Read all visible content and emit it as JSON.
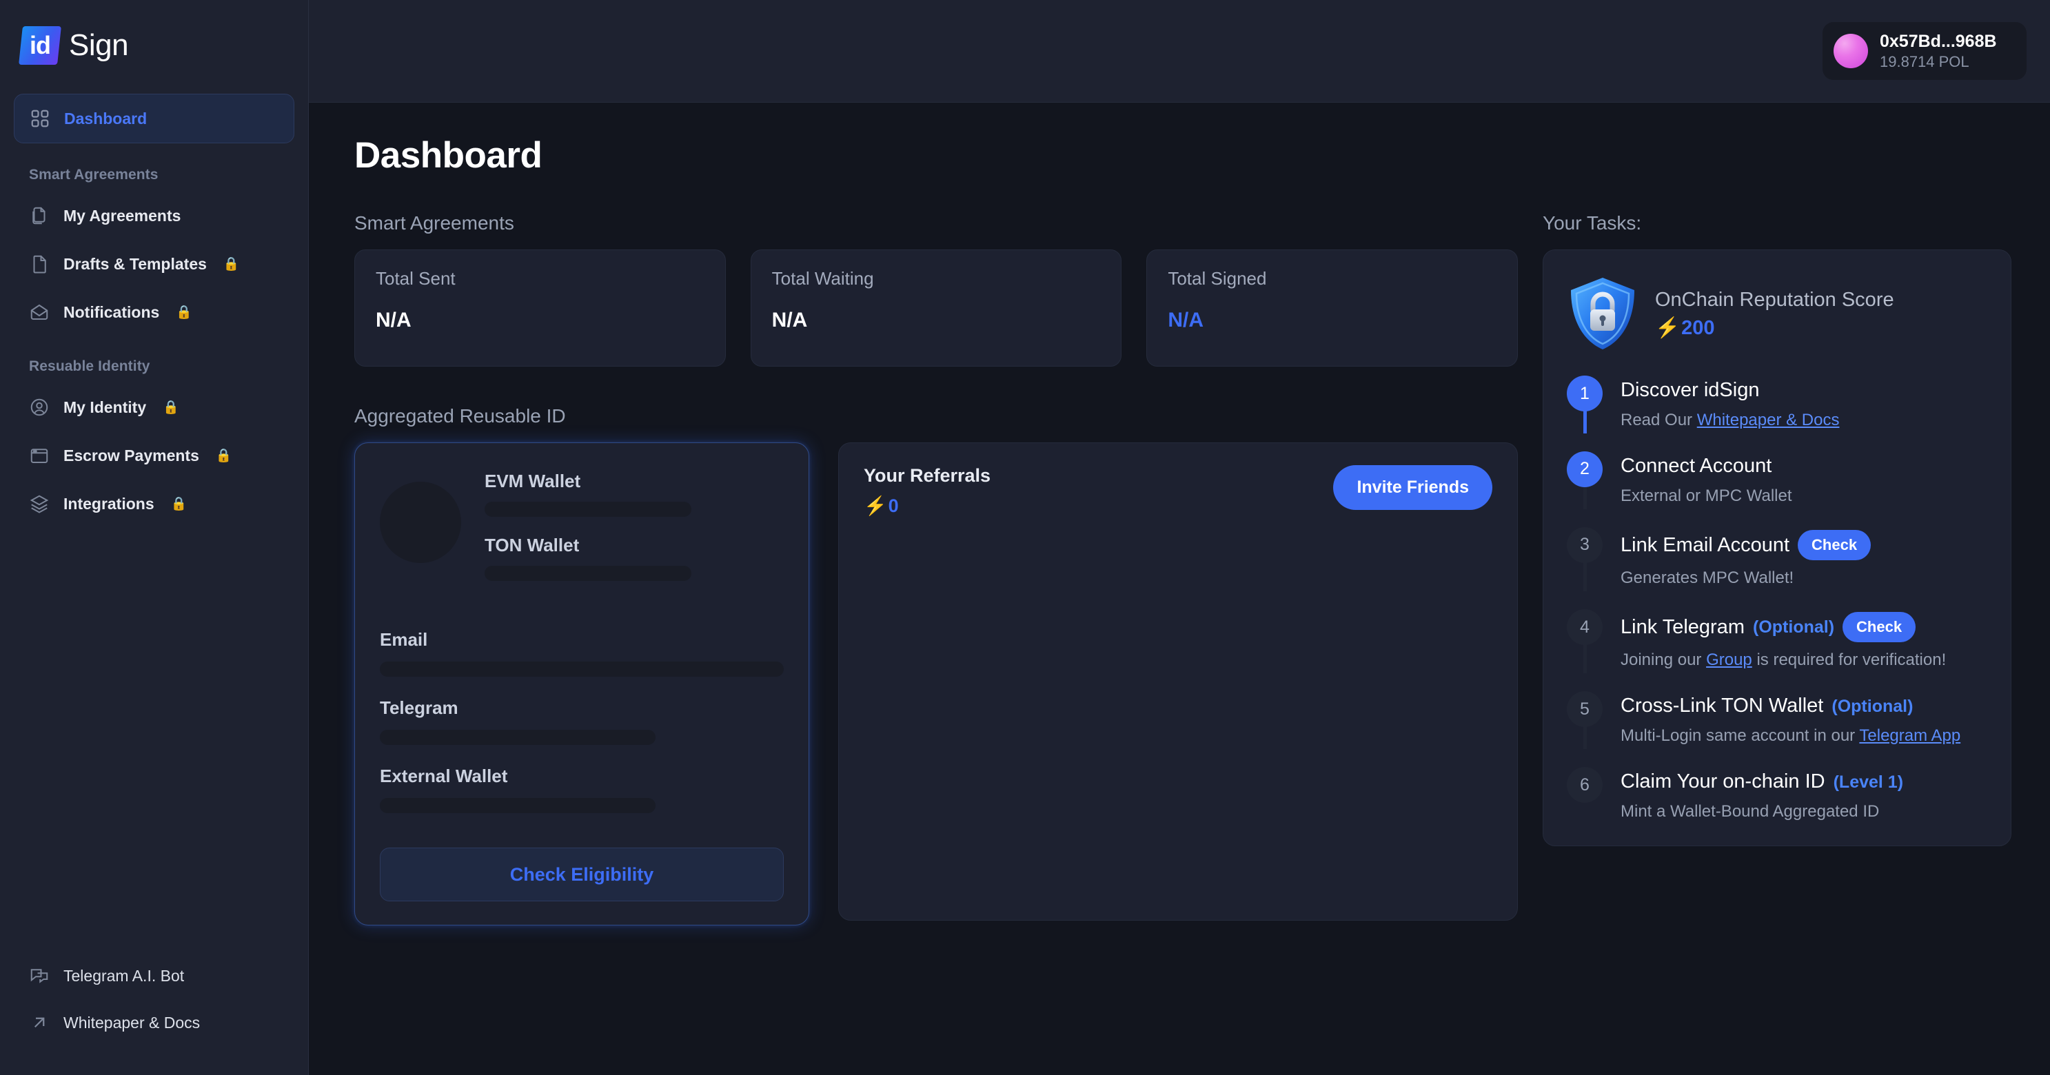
{
  "brand": {
    "mark": "id",
    "name": "Sign"
  },
  "sidebar": {
    "primary": [
      {
        "label": "Dashboard",
        "icon": "grid-icon",
        "locked": false,
        "active": true
      }
    ],
    "sections": [
      {
        "title": "Smart Agreements",
        "items": [
          {
            "label": "My Agreements",
            "icon": "documents-icon",
            "lock": ""
          },
          {
            "label": "Drafts & Templates",
            "icon": "document-icon",
            "lock": "🔒"
          },
          {
            "label": "Notifications",
            "icon": "envelope-open-icon",
            "lock": "🔒"
          }
        ]
      },
      {
        "title": "Resuable Identity",
        "items": [
          {
            "label": "My Identity",
            "icon": "user-circle-icon",
            "lock": "🔒"
          },
          {
            "label": "Escrow Payments",
            "icon": "browser-window-icon",
            "lock": "🔒"
          },
          {
            "label": "Integrations",
            "icon": "layers-icon",
            "lock": "🔒"
          }
        ]
      }
    ],
    "footer": [
      {
        "label": "Telegram A.I. Bot",
        "icon": "chat-bubbles-icon"
      },
      {
        "label": "Whitepaper & Docs",
        "icon": "arrow-up-right-icon"
      }
    ]
  },
  "topbar": {
    "wallet": {
      "address": "0x57Bd...968B",
      "balance": "19.8714 POL"
    }
  },
  "page": {
    "title": "Dashboard"
  },
  "smart_agreements": {
    "section_label": "Smart Agreements",
    "stats": [
      {
        "label": "Total Sent",
        "value": "N/A",
        "accent": false
      },
      {
        "label": "Total Waiting",
        "value": "N/A",
        "accent": false
      },
      {
        "label": "Total Signed",
        "value": "N/A",
        "accent": true
      }
    ]
  },
  "aggregated_id": {
    "section_label": "Aggregated Reusable ID",
    "evm_label": "EVM Wallet",
    "ton_label": "TON Wallet",
    "email_label": "Email",
    "telegram_label": "Telegram",
    "external_label": "External Wallet",
    "check_button": "Check Eligibility"
  },
  "referrals": {
    "title": "Your Referrals",
    "bolt": "⚡",
    "count": "0",
    "invite_button": "Invite Friends"
  },
  "tasks": {
    "heading": "Your Tasks:",
    "score": {
      "label": "OnChain Reputation Score",
      "bolt": "⚡",
      "value": "200"
    },
    "items": [
      {
        "number": "1",
        "state": "done",
        "title": "Discover idSign",
        "tag": "",
        "button": "",
        "desc_prefix": "Read Our ",
        "desc_link": "Whitepaper & Docs",
        "desc_suffix": ""
      },
      {
        "number": "2",
        "state": "done",
        "title": "Connect Account",
        "tag": "",
        "button": "",
        "desc_prefix": "External or MPC Wallet",
        "desc_link": "",
        "desc_suffix": ""
      },
      {
        "number": "3",
        "state": "todo",
        "title": "Link Email Account",
        "tag": "",
        "button": "Check",
        "desc_prefix": "Generates MPC Wallet!",
        "desc_link": "",
        "desc_suffix": ""
      },
      {
        "number": "4",
        "state": "todo",
        "title": "Link Telegram",
        "tag": "(Optional)",
        "button": "Check",
        "desc_prefix": "Joining our ",
        "desc_link": "Group",
        "desc_suffix": " is required for verification!"
      },
      {
        "number": "5",
        "state": "todo",
        "title": "Cross-Link TON Wallet",
        "tag": "(Optional)",
        "button": "",
        "desc_prefix": "Multi-Login same account in our ",
        "desc_link": "Telegram App",
        "desc_suffix": ""
      },
      {
        "number": "6",
        "state": "todo",
        "title": "Claim Your on-chain ID",
        "tag": "(Level 1)",
        "button": "",
        "desc_prefix": "Mint a Wallet-Bound Aggregated ID",
        "desc_link": "",
        "desc_suffix": ""
      }
    ]
  },
  "colors": {
    "accent": "#3d6df5",
    "link": "#5b8cfa",
    "bolt": "#f5c24a",
    "sidebar_bg": "#1e2230",
    "page_bg": "#12151e",
    "card_bg": "#1d2130"
  }
}
